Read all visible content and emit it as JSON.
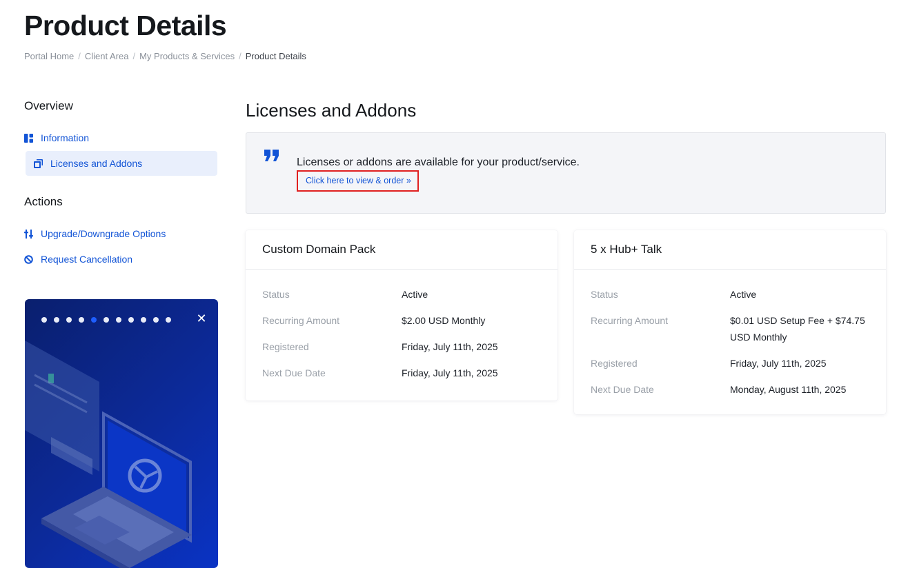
{
  "header": {
    "title": "Product Details",
    "breadcrumb": [
      "Portal Home",
      "Client Area",
      "My Products & Services",
      "Product Details"
    ]
  },
  "sidebar": {
    "overview_heading": "Overview",
    "overview_items": [
      {
        "label": "Information",
        "icon": "dashboard-icon"
      },
      {
        "label": "Licenses and Addons",
        "icon": "addons-icon",
        "active": true
      }
    ],
    "actions_heading": "Actions",
    "action_items": [
      {
        "label": "Upgrade/Downgrade Options",
        "icon": "sliders-icon"
      },
      {
        "label": "Request Cancellation",
        "icon": "ban-icon"
      }
    ],
    "promo": {
      "slide_count": 11,
      "active_slide": 5,
      "close_icon": "close-icon"
    }
  },
  "main": {
    "section_title": "Licenses and Addons",
    "notice": {
      "icon": "quote-icon",
      "message": "Licenses or addons are available for your product/service.",
      "link_label": "Click here to view & order »"
    },
    "cards": [
      {
        "title": "Custom Domain Pack",
        "rows": [
          {
            "label": "Status",
            "value": "Active"
          },
          {
            "label": "Recurring Amount",
            "value": "$2.00 USD Monthly"
          },
          {
            "label": "Registered",
            "value": "Friday, July 11th, 2025"
          },
          {
            "label": "Next Due Date",
            "value": "Friday, July 11th, 2025"
          }
        ]
      },
      {
        "title": "5 x Hub+ Talk",
        "rows": [
          {
            "label": "Status",
            "value": "Active"
          },
          {
            "label": "Recurring Amount",
            "value": "$0.01 USD Setup Fee + $74.75 USD Monthly"
          },
          {
            "label": "Registered",
            "value": "Friday, July 11th, 2025"
          },
          {
            "label": "Next Due Date",
            "value": "Monday, August 11th, 2025"
          }
        ]
      }
    ]
  },
  "colors": {
    "accent": "#1254d6",
    "highlight_border": "#e02020",
    "promo_background": "#0c2a9a"
  }
}
